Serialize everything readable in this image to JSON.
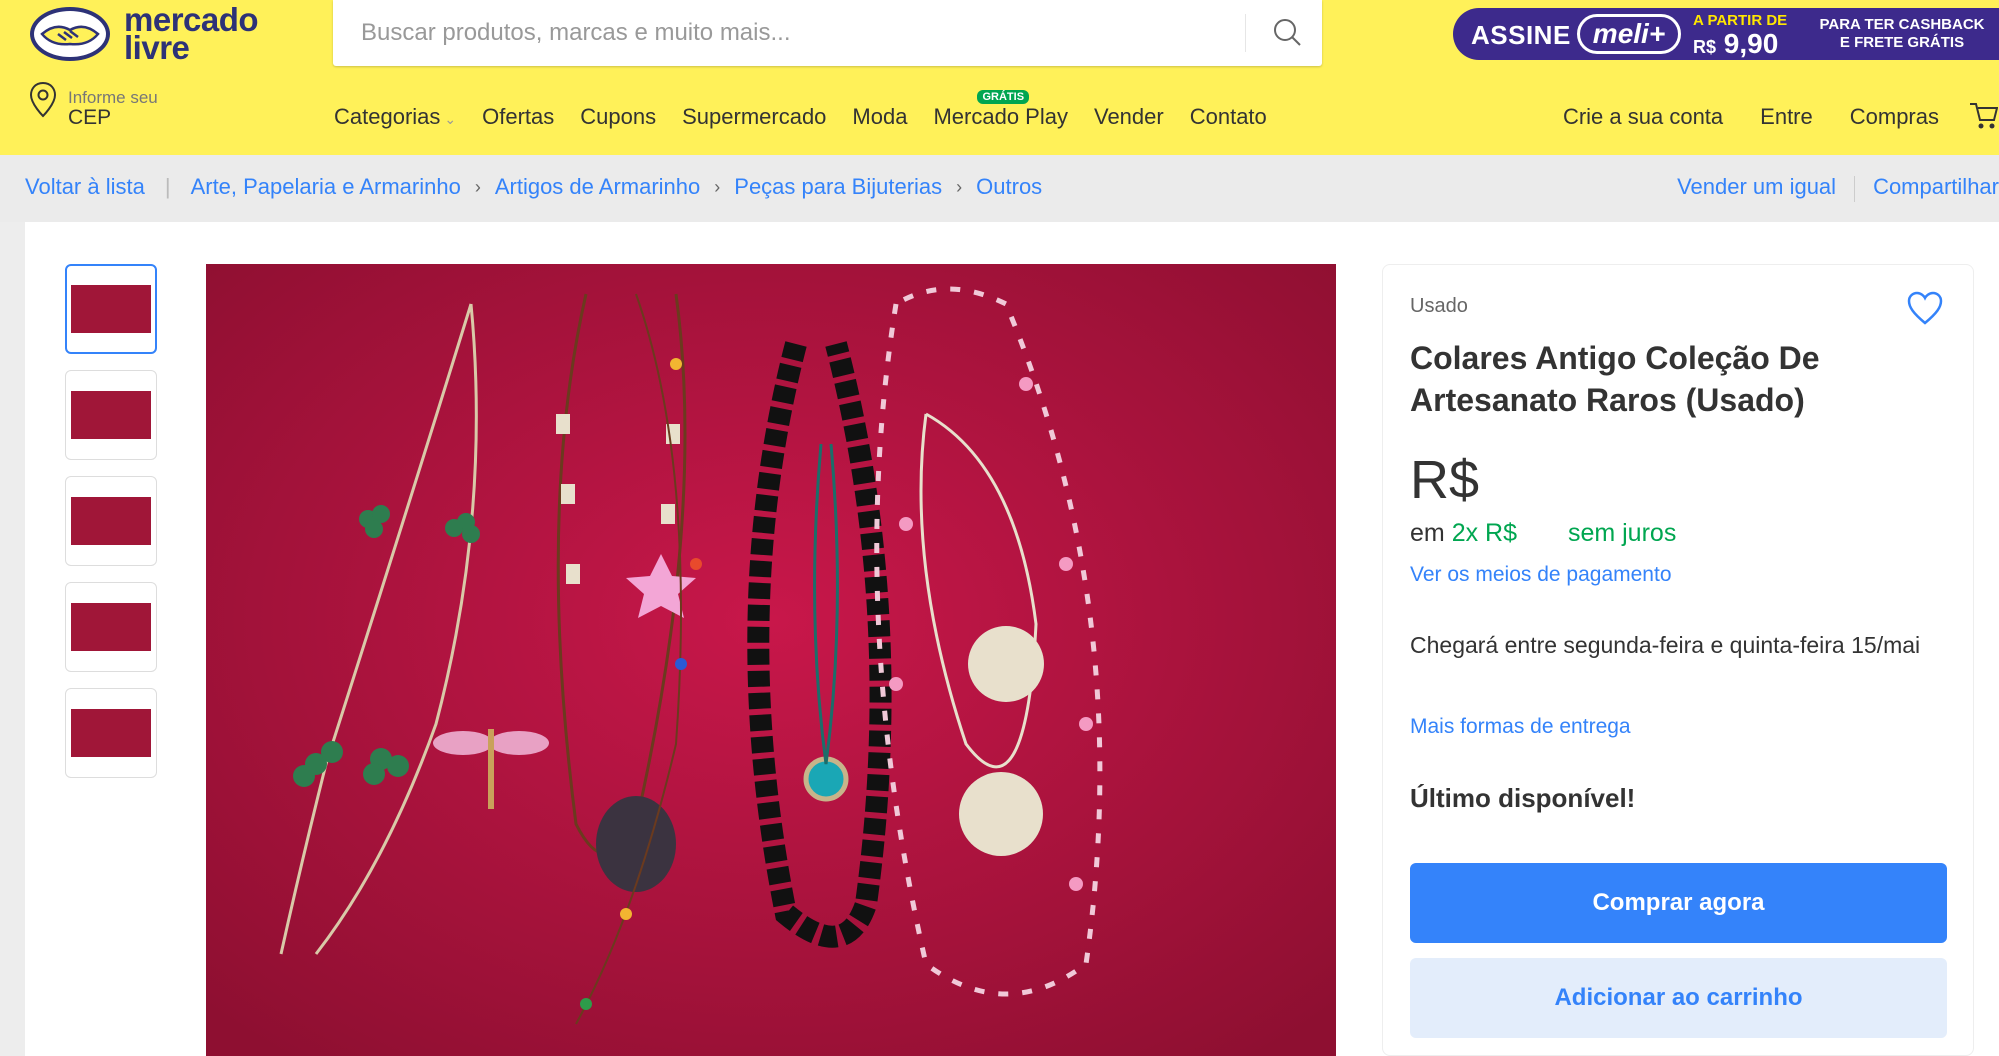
{
  "header": {
    "logo_text_line1": "mercado",
    "logo_text_line2": "livre",
    "search_placeholder": "Buscar produtos, marcas e muito mais...",
    "promo": {
      "assine": "ASSINE",
      "brand": "meli+",
      "a_partir_de": "A PARTIR DE",
      "currency": "R$",
      "price": "9,90",
      "cashback_line1": "PARA TER CASHBACK",
      "cashback_line2": "E FRETE GRÁTIS"
    },
    "cep_small": "Informe seu",
    "cep_big": "CEP",
    "nav": [
      "Categorias",
      "Ofertas",
      "Cupons",
      "Supermercado",
      "Moda",
      "Mercado Play",
      "Vender",
      "Contato"
    ],
    "nav_badge": "GRÁTIS",
    "nav_right": [
      "Crie a sua conta",
      "Entre",
      "Compras"
    ],
    "colors": {
      "header_bg": "#fff159",
      "accent": "#3483fa",
      "green": "#00a650",
      "promo_bg": "#3d2a8c"
    }
  },
  "breadcrumb": {
    "back": "Voltar à lista",
    "items": [
      "Arte, Papelaria e Armarinho",
      "Artigos de Armarinho",
      "Peças para Bijuterias",
      "Outros"
    ],
    "sell_similar": "Vender um igual",
    "share": "Compartilhar"
  },
  "product": {
    "condition": "Usado",
    "title": "Colares Antigo Coleção De Artesanato Raros (Usado)",
    "price_currency": "R$",
    "installments_prefix": "em",
    "installments_count": "2x R$",
    "installments_suffix": "sem juros",
    "payment_link": "Ver os meios de pagamento",
    "delivery_text": "Chegará entre segunda-feira e quinta-feira 15/mai",
    "delivery_link": "Mais formas de entrega",
    "stock": "Último disponível!",
    "buy_now": "Comprar agora",
    "add_to_cart": "Adicionar ao carrinho",
    "thumbnail_count": 5
  }
}
